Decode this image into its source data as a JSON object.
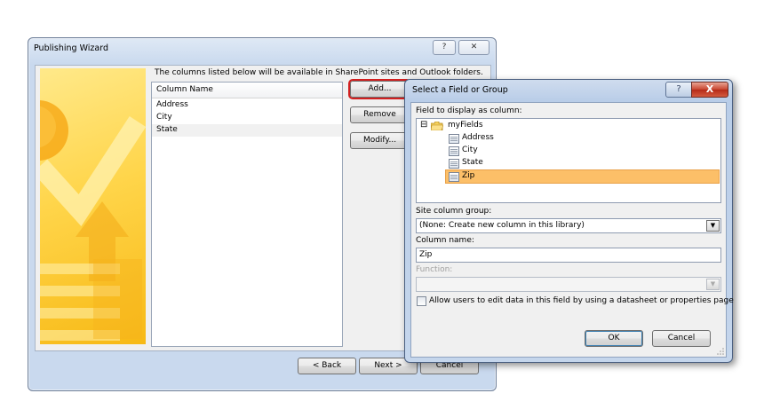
{
  "wizard": {
    "title": "Publishing Wizard",
    "help_label": "?",
    "close_label": "✕",
    "description": "The columns listed below will be available in SharePoint sites and Outlook folders.",
    "column_header": "Column Name",
    "columns": [
      "Address",
      "City",
      "State"
    ],
    "buttons": {
      "add": "Add...",
      "remove": "Remove",
      "modify": "Modify..."
    },
    "footer": {
      "back": "< Back",
      "next": "Next >",
      "cancel": "Cancel"
    },
    "banner_color": "#ffd54a"
  },
  "dialog": {
    "title": "Select a Field or Group",
    "help_label": "?",
    "close_label": "X",
    "field_label": "Field to display as column:",
    "tree": {
      "expander": "⊟",
      "root": "myFields",
      "children": [
        "Address",
        "City",
        "State",
        "Zip"
      ],
      "selected": "Zip"
    },
    "site_column_group_label": "Site column group:",
    "site_column_group_value": "(None: Create new column in this library)",
    "column_name_label": "Column name:",
    "column_name_value": "Zip",
    "function_label": "Function:",
    "function_value": "",
    "allow_edit_label": "Allow users to edit data in this field by using a datasheet or properties page",
    "allow_edit_checked": false,
    "ok_label": "OK",
    "cancel_label": "Cancel",
    "selection_color": "#fcbf68"
  }
}
